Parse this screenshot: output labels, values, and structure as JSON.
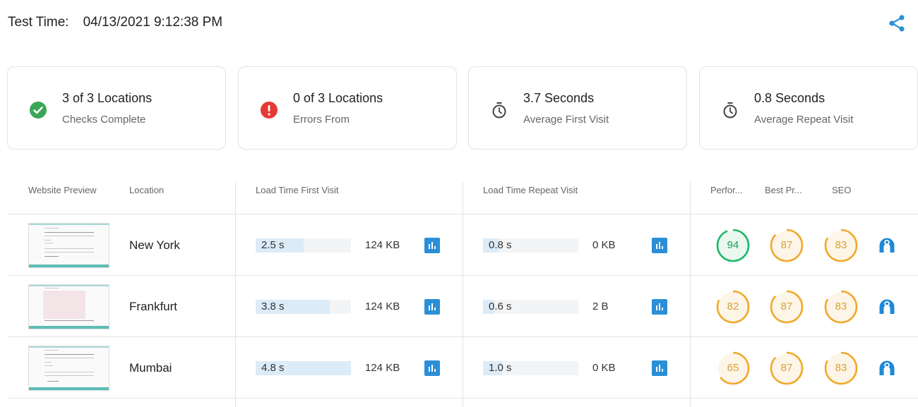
{
  "header": {
    "label": "Test Time:",
    "value": "04/13/2021 9:12:38 PM",
    "share_icon": "share-icon"
  },
  "summary_cards": [
    {
      "icon": "check-circle-icon",
      "title": "3 of 3 Locations",
      "subtitle": "Checks Complete",
      "color": "#3aa655"
    },
    {
      "icon": "error-circle-icon",
      "title": "0 of 3 Locations",
      "subtitle": "Errors From",
      "color": "#e53935"
    },
    {
      "icon": "stopwatch-icon",
      "title": "3.7 Seconds",
      "subtitle": "Average First Visit",
      "color": "#444444"
    },
    {
      "icon": "stopwatch-icon",
      "title": "0.8 Seconds",
      "subtitle": "Average Repeat Visit",
      "color": "#444444"
    }
  ],
  "table": {
    "headers": {
      "preview": "Website Preview",
      "location": "Location",
      "first_visit": "Load Time First Visit",
      "repeat_visit": "Load Time Repeat Visit",
      "performance": "Perfor...",
      "best_practices": "Best Pr...",
      "seo": "SEO"
    },
    "rows": [
      {
        "location": "New York",
        "first_visit": {
          "time": "2.5 s",
          "fraction": 0.5,
          "size": "124 KB"
        },
        "repeat_visit": {
          "time": "0.8 s",
          "fraction": 0.16,
          "size": "0 KB"
        },
        "scores": {
          "performance": 94,
          "best_practices": 87,
          "seo": 83
        },
        "preview_variant": "text"
      },
      {
        "location": "Frankfurt",
        "first_visit": {
          "time": "3.8 s",
          "fraction": 0.78,
          "size": "124 KB"
        },
        "repeat_visit": {
          "time": "0.6 s",
          "fraction": 0.12,
          "size": "2 B"
        },
        "scores": {
          "performance": 82,
          "best_practices": 87,
          "seo": 83
        },
        "preview_variant": "image"
      },
      {
        "location": "Mumbai",
        "first_visit": {
          "time": "4.8 s",
          "fraction": 1.0,
          "size": "124 KB"
        },
        "repeat_visit": {
          "time": "1.0 s",
          "fraction": 0.2,
          "size": "0 KB"
        },
        "scores": {
          "performance": 65,
          "best_practices": 87,
          "seo": 83
        },
        "preview_variant": "text"
      }
    ]
  },
  "colors": {
    "accent": "#2a8fd6",
    "score_good": "#1fb86b",
    "score_average": "#f0a92b",
    "score_good_text": "#1a9e5c",
    "score_average_text": "#d9a233"
  }
}
